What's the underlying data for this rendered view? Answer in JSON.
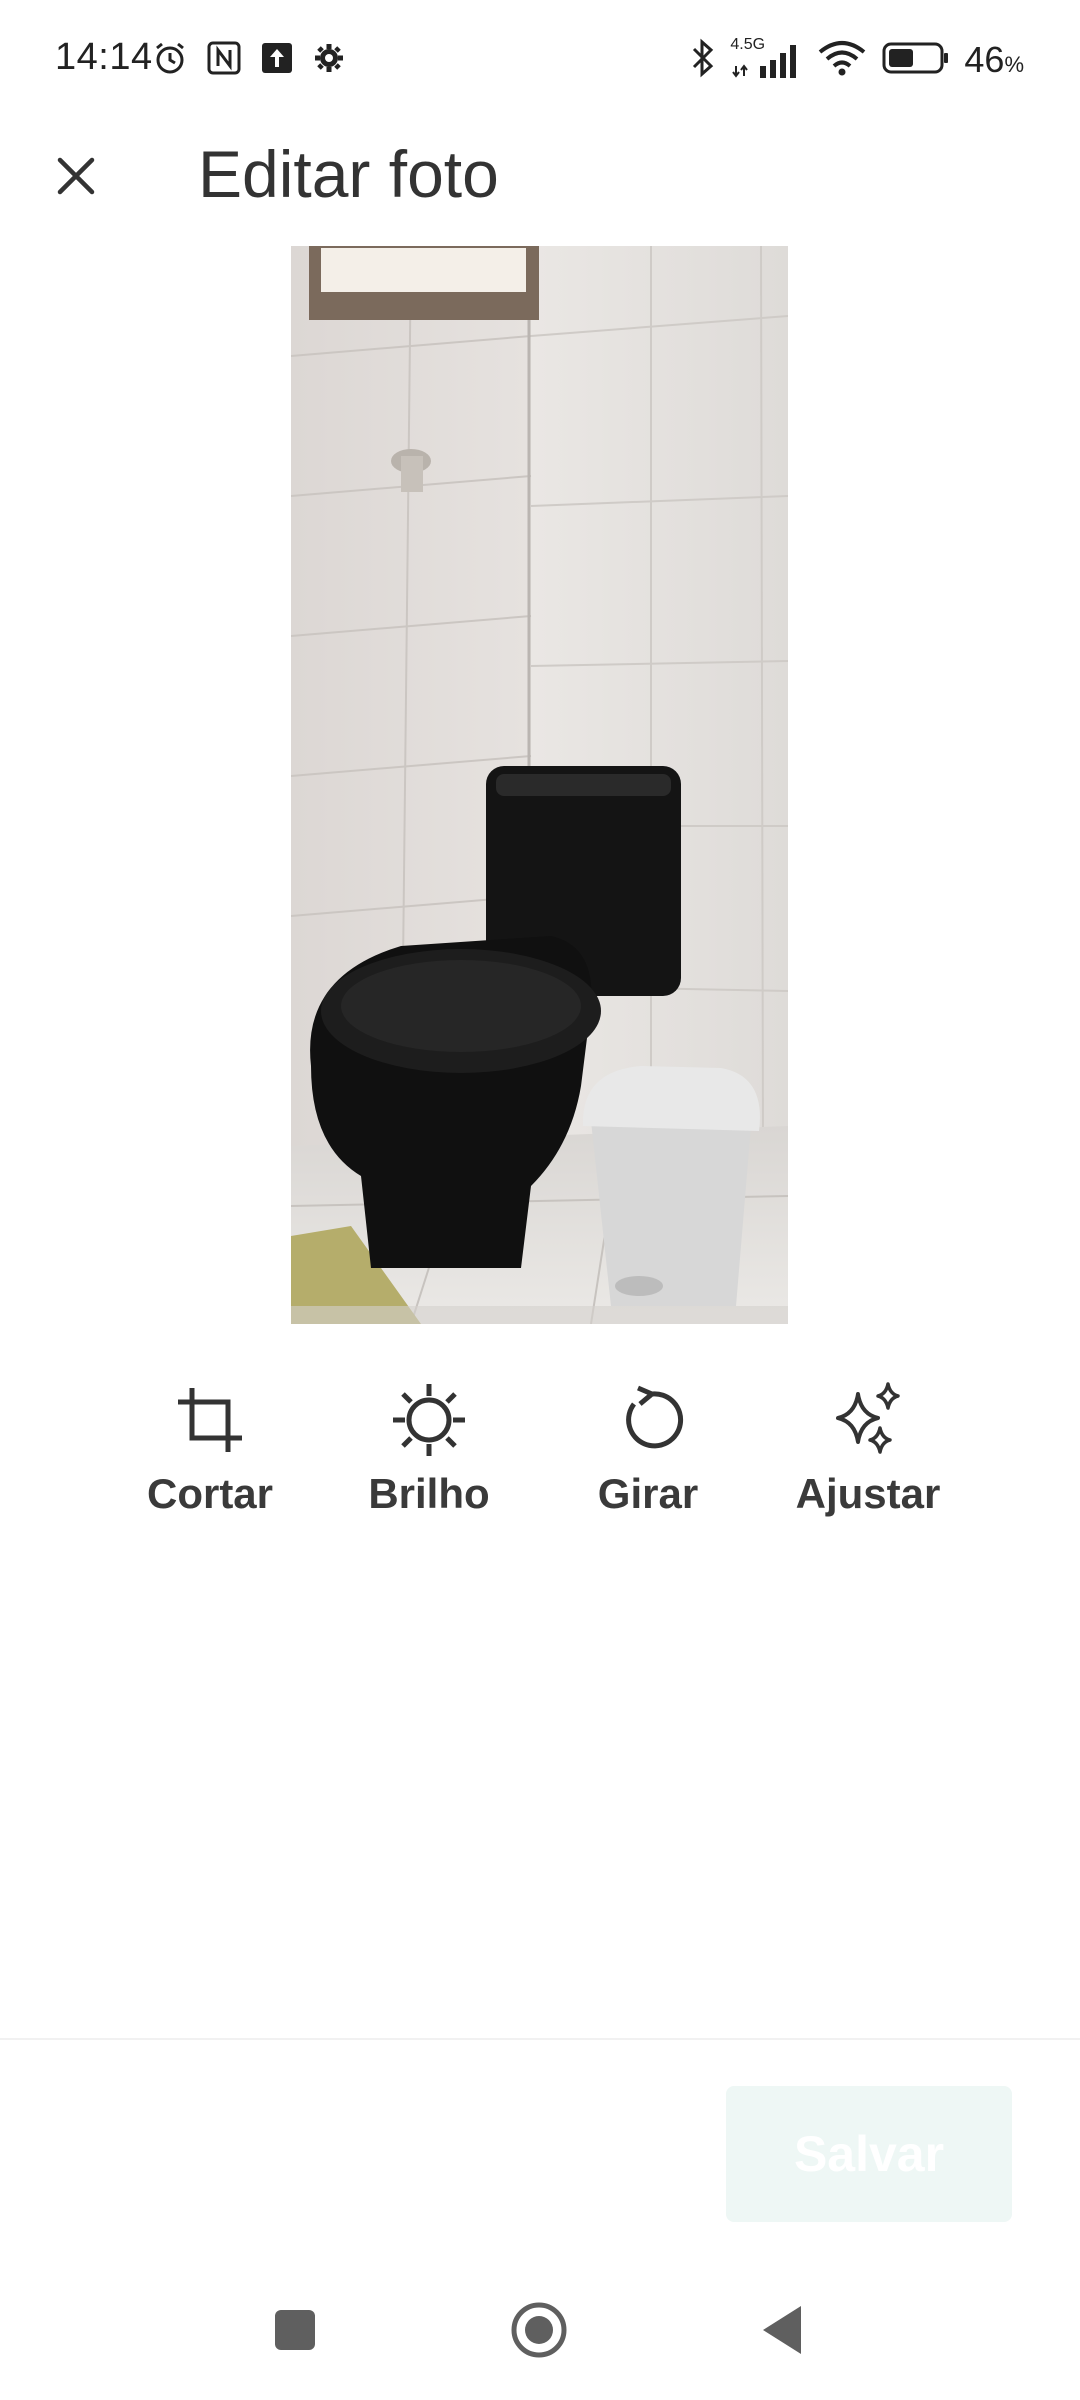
{
  "status_bar": {
    "time": "14:14",
    "network_label": "4.5G",
    "battery_percent": "46",
    "battery_unit": "%",
    "icons": [
      "alarm-icon",
      "nfc-icon",
      "upload-icon",
      "settings-icon",
      "bluetooth-icon",
      "signal-icon",
      "wifi-icon",
      "battery-icon"
    ]
  },
  "header": {
    "title": "Editar foto",
    "close_icon": "close-icon"
  },
  "tools": [
    {
      "label": "Cortar",
      "icon": "crop-icon"
    },
    {
      "label": "Brilho",
      "icon": "brightness-icon"
    },
    {
      "label": "Girar",
      "icon": "rotate-icon"
    },
    {
      "label": "Ajustar",
      "icon": "sparkle-icon"
    }
  ],
  "footer": {
    "save_label": "Salvar"
  },
  "colors": {
    "text": "#333333",
    "save_bg": "#eef7f5"
  },
  "nav": [
    "recents-icon",
    "home-icon",
    "back-icon"
  ]
}
